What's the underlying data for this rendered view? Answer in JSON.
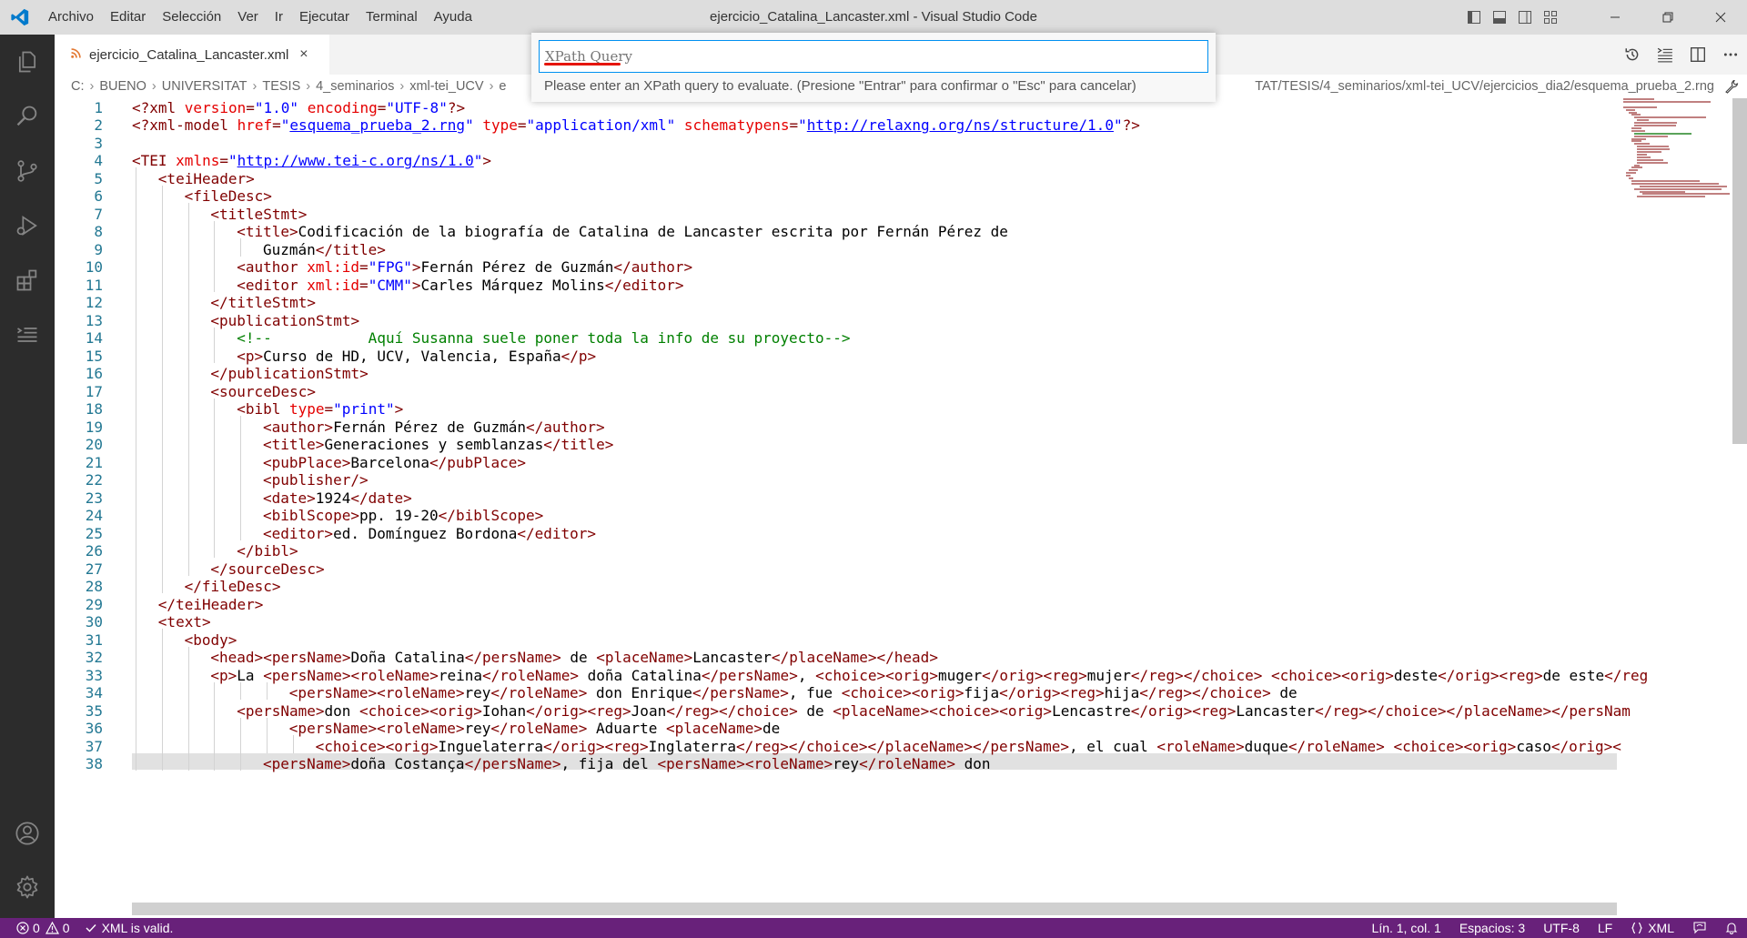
{
  "window": {
    "title": "ejercicio_Catalina_Lancaster.xml - Visual Studio Code",
    "menu": [
      "Archivo",
      "Editar",
      "Selección",
      "Ver",
      "Ir",
      "Ejecutar",
      "Terminal",
      "Ayuda"
    ],
    "accent": "#68217a"
  },
  "tab": {
    "label": "ejercicio_Catalina_Lancaster.xml",
    "close_glyph": "×",
    "icon": "rss-feed-icon"
  },
  "breadcrumb": {
    "left": [
      "C:",
      "BUENO",
      "UNIVERSITAT",
      "TESIS",
      "4_seminarios",
      "xml-tei_UCV",
      "e"
    ],
    "right": "TAT/TESIS/4_seminarios/xml-tei_UCV/ejercicios_dia2/esquema_prueba_2.rng",
    "separator": "›"
  },
  "quick_input": {
    "placeholder": "XPath Query",
    "message": "Please enter an XPath query to evaluate. (Presione \"Entrar\" para confirmar o \"Esc\" para cancelar)"
  },
  "editor": {
    "lines": [
      {
        "n": "1",
        "indent": 0,
        "segs": [
          [
            "t",
            "<?xml "
          ],
          [
            "a",
            "version"
          ],
          [
            "t",
            "="
          ],
          [
            "v",
            "\"1.0\""
          ],
          [
            "t",
            " "
          ],
          [
            "a",
            "encoding"
          ],
          [
            "t",
            "="
          ],
          [
            "v",
            "\"UTF-8\""
          ],
          [
            "t",
            "?>"
          ]
        ]
      },
      {
        "n": "2",
        "indent": 0,
        "segs": [
          [
            "t",
            "<?xml-model "
          ],
          [
            "a",
            "href"
          ],
          [
            "t",
            "="
          ],
          [
            "v",
            "\""
          ],
          [
            "vu",
            "esquema_prueba_2.rng"
          ],
          [
            "v",
            "\""
          ],
          [
            "t",
            " "
          ],
          [
            "a",
            "type"
          ],
          [
            "t",
            "="
          ],
          [
            "v",
            "\"application/xml\""
          ],
          [
            "t",
            " "
          ],
          [
            "a",
            "schematypens"
          ],
          [
            "t",
            "="
          ],
          [
            "v",
            "\""
          ],
          [
            "vu",
            "http://relaxng.org/ns/structure/1.0"
          ],
          [
            "v",
            "\""
          ],
          [
            "t",
            "?>"
          ]
        ]
      },
      {
        "n": "3",
        "indent": 0,
        "segs": []
      },
      {
        "n": "4",
        "indent": 0,
        "segs": [
          [
            "t",
            "<TEI "
          ],
          [
            "a",
            "xmlns"
          ],
          [
            "t",
            "="
          ],
          [
            "v",
            "\""
          ],
          [
            "vu",
            "http://www.tei-c.org/ns/1.0"
          ],
          [
            "v",
            "\""
          ],
          [
            "t",
            ">"
          ]
        ]
      },
      {
        "n": "5",
        "indent": 1,
        "segs": [
          [
            "t",
            "<teiHeader>"
          ]
        ]
      },
      {
        "n": "6",
        "indent": 2,
        "segs": [
          [
            "t",
            "<fileDesc>"
          ]
        ]
      },
      {
        "n": "7",
        "indent": 3,
        "segs": [
          [
            "t",
            "<titleStmt>"
          ]
        ]
      },
      {
        "n": "8",
        "indent": 4,
        "segs": [
          [
            "t",
            "<title>"
          ],
          [
            "x",
            "Codificación de la biografía de Catalina de Lancaster escrita por Fernán Pérez de"
          ]
        ]
      },
      {
        "n": "9",
        "indent": 5,
        "segs": [
          [
            "x",
            "Guzmán"
          ],
          [
            "t",
            "</title>"
          ]
        ]
      },
      {
        "n": "10",
        "indent": 4,
        "segs": [
          [
            "t",
            "<author "
          ],
          [
            "a",
            "xml:id"
          ],
          [
            "t",
            "="
          ],
          [
            "v",
            "\"FPG\""
          ],
          [
            "t",
            ">"
          ],
          [
            "x",
            "Fernán Pérez de Guzmán"
          ],
          [
            "t",
            "</author>"
          ]
        ]
      },
      {
        "n": "11",
        "indent": 4,
        "segs": [
          [
            "t",
            "<editor "
          ],
          [
            "a",
            "xml:id"
          ],
          [
            "t",
            "="
          ],
          [
            "v",
            "\"CMM\""
          ],
          [
            "t",
            ">"
          ],
          [
            "x",
            "Carles Márquez Molins"
          ],
          [
            "t",
            "</editor>"
          ]
        ]
      },
      {
        "n": "12",
        "indent": 3,
        "segs": [
          [
            "t",
            "</titleStmt>"
          ]
        ]
      },
      {
        "n": "13",
        "indent": 3,
        "segs": [
          [
            "t",
            "<publicationStmt>"
          ]
        ]
      },
      {
        "n": "14",
        "indent": 4,
        "segs": [
          [
            "c",
            "<!--           Aquí Susanna suele poner toda la info de su proyecto-->"
          ]
        ]
      },
      {
        "n": "15",
        "indent": 4,
        "segs": [
          [
            "t",
            "<p>"
          ],
          [
            "x",
            "Curso de HD, UCV, Valencia, España"
          ],
          [
            "t",
            "</p>"
          ]
        ]
      },
      {
        "n": "16",
        "indent": 3,
        "segs": [
          [
            "t",
            "</publicationStmt>"
          ]
        ]
      },
      {
        "n": "17",
        "indent": 3,
        "segs": [
          [
            "t",
            "<sourceDesc>"
          ]
        ]
      },
      {
        "n": "18",
        "indent": 4,
        "segs": [
          [
            "t",
            "<bibl "
          ],
          [
            "a",
            "type"
          ],
          [
            "t",
            "="
          ],
          [
            "v",
            "\"print\""
          ],
          [
            "t",
            ">"
          ]
        ]
      },
      {
        "n": "19",
        "indent": 5,
        "segs": [
          [
            "t",
            "<author>"
          ],
          [
            "x",
            "Fernán Pérez de Guzmán"
          ],
          [
            "t",
            "</author>"
          ]
        ]
      },
      {
        "n": "20",
        "indent": 5,
        "segs": [
          [
            "t",
            "<title>"
          ],
          [
            "x",
            "Generaciones y semblanzas"
          ],
          [
            "t",
            "</title>"
          ]
        ]
      },
      {
        "n": "21",
        "indent": 5,
        "segs": [
          [
            "t",
            "<pubPlace>"
          ],
          [
            "x",
            "Barcelona"
          ],
          [
            "t",
            "</pubPlace>"
          ]
        ]
      },
      {
        "n": "22",
        "indent": 5,
        "segs": [
          [
            "t",
            "<publisher/>"
          ]
        ]
      },
      {
        "n": "23",
        "indent": 5,
        "segs": [
          [
            "t",
            "<date>"
          ],
          [
            "x",
            "1924"
          ],
          [
            "t",
            "</date>"
          ]
        ]
      },
      {
        "n": "24",
        "indent": 5,
        "segs": [
          [
            "t",
            "<biblScope>"
          ],
          [
            "x",
            "pp. 19-20"
          ],
          [
            "t",
            "</biblScope>"
          ]
        ]
      },
      {
        "n": "25",
        "indent": 5,
        "segs": [
          [
            "t",
            "<editor>"
          ],
          [
            "x",
            "ed. Domínguez Bordona"
          ],
          [
            "t",
            "</editor>"
          ]
        ]
      },
      {
        "n": "26",
        "indent": 4,
        "segs": [
          [
            "t",
            "</bibl>"
          ]
        ]
      },
      {
        "n": "27",
        "indent": 3,
        "segs": [
          [
            "t",
            "</sourceDesc>"
          ]
        ]
      },
      {
        "n": "28",
        "indent": 2,
        "segs": [
          [
            "t",
            "</fileDesc>"
          ]
        ]
      },
      {
        "n": "29",
        "indent": 1,
        "segs": [
          [
            "t",
            "</teiHeader>"
          ]
        ]
      },
      {
        "n": "30",
        "indent": 1,
        "segs": [
          [
            "t",
            "<text>"
          ]
        ]
      },
      {
        "n": "31",
        "indent": 2,
        "segs": [
          [
            "t",
            "<body>"
          ]
        ]
      },
      {
        "n": "32",
        "indent": 3,
        "segs": [
          [
            "t",
            "<head><persName>"
          ],
          [
            "x",
            "Doña Catalina"
          ],
          [
            "t",
            "</persName>"
          ],
          [
            "x",
            " de "
          ],
          [
            "t",
            "<placeName>"
          ],
          [
            "x",
            "Lancaster"
          ],
          [
            "t",
            "</placeName></head>"
          ]
        ]
      },
      {
        "n": "33",
        "indent": 3,
        "segs": [
          [
            "t",
            "<p>"
          ],
          [
            "x",
            "La "
          ],
          [
            "t",
            "<persName><roleName>"
          ],
          [
            "x",
            "reina"
          ],
          [
            "t",
            "</roleName>"
          ],
          [
            "x",
            " doña Catalina"
          ],
          [
            "t",
            "</persName>"
          ],
          [
            "x",
            ", "
          ],
          [
            "t",
            "<choice><orig>"
          ],
          [
            "x",
            "muger"
          ],
          [
            "t",
            "</orig><reg>"
          ],
          [
            "x",
            "mujer"
          ],
          [
            "t",
            "</reg></choice>"
          ],
          [
            "x",
            " "
          ],
          [
            "t",
            "<choice><orig>"
          ],
          [
            "x",
            "deste"
          ],
          [
            "t",
            "</orig><reg>"
          ],
          [
            "x",
            "de este"
          ],
          [
            "t",
            "</reg"
          ]
        ]
      },
      {
        "n": "34",
        "indent": 6,
        "segs": [
          [
            "t",
            "<persName><roleName>"
          ],
          [
            "x",
            "rey"
          ],
          [
            "t",
            "</roleName>"
          ],
          [
            "x",
            " don Enrique"
          ],
          [
            "t",
            "</persName>"
          ],
          [
            "x",
            ", fue "
          ],
          [
            "t",
            "<choice><orig>"
          ],
          [
            "x",
            "fija"
          ],
          [
            "t",
            "</orig><reg>"
          ],
          [
            "x",
            "hija"
          ],
          [
            "t",
            "</reg></choice>"
          ],
          [
            "x",
            " de"
          ]
        ]
      },
      {
        "n": "35",
        "indent": 4,
        "segs": [
          [
            "t",
            "<persName>"
          ],
          [
            "x",
            "don "
          ],
          [
            "t",
            "<choice><orig>"
          ],
          [
            "x",
            "Iohan"
          ],
          [
            "t",
            "</orig><reg>"
          ],
          [
            "x",
            "Joan"
          ],
          [
            "t",
            "</reg></choice>"
          ],
          [
            "x",
            " de "
          ],
          [
            "t",
            "<placeName><choice><orig>"
          ],
          [
            "x",
            "Lencastre"
          ],
          [
            "t",
            "</orig><reg>"
          ],
          [
            "x",
            "Lancaster"
          ],
          [
            "t",
            "</reg></choice></placeName></persNam"
          ]
        ]
      },
      {
        "n": "36",
        "indent": 6,
        "segs": [
          [
            "t",
            "<persName><roleName>"
          ],
          [
            "x",
            "rey"
          ],
          [
            "t",
            "</roleName>"
          ],
          [
            "x",
            " Aduarte "
          ],
          [
            "t",
            "<placeName>"
          ],
          [
            "x",
            "de"
          ]
        ]
      },
      {
        "n": "37",
        "indent": 7,
        "segs": [
          [
            "t",
            "<choice><orig>"
          ],
          [
            "x",
            "Inguelaterra"
          ],
          [
            "t",
            "</orig><reg>"
          ],
          [
            "x",
            "Inglaterra"
          ],
          [
            "t",
            "</reg></choice></placeName></persName>"
          ],
          [
            "x",
            ", el cual "
          ],
          [
            "t",
            "<roleName>"
          ],
          [
            "x",
            "duque"
          ],
          [
            "t",
            "</roleName>"
          ],
          [
            "x",
            " "
          ],
          [
            "t",
            "<choice><orig>"
          ],
          [
            "x",
            "caso"
          ],
          [
            "t",
            "</orig><"
          ]
        ]
      },
      {
        "n": "38",
        "indent": 5,
        "segs": [
          [
            "t",
            "<persName>"
          ],
          [
            "x",
            "doña Costança"
          ],
          [
            "t",
            "</persName>"
          ],
          [
            "x",
            ", fija del "
          ],
          [
            "t",
            "<persName><roleName>"
          ],
          [
            "x",
            "rey"
          ],
          [
            "t",
            "</roleName>"
          ],
          [
            "x",
            " don"
          ]
        ]
      }
    ]
  },
  "statusbar": {
    "errors": "0",
    "warnings": "0",
    "valid": "XML is valid.",
    "position": "Lín. 1, col. 1",
    "spaces": "Espacios: 3",
    "encoding": "UTF-8",
    "eol": "LF",
    "language": "XML"
  }
}
